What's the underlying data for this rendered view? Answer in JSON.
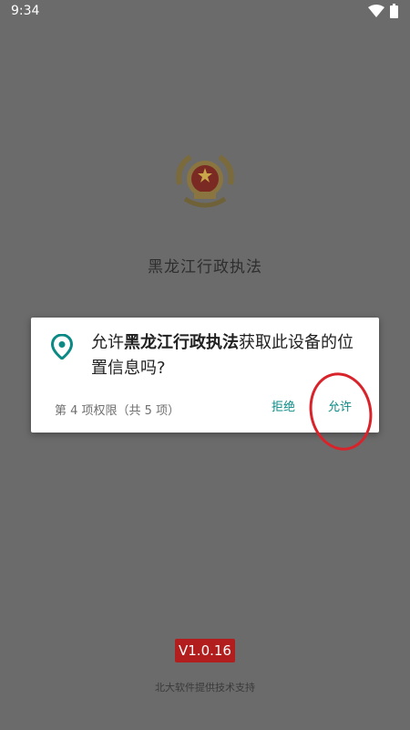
{
  "status_bar": {
    "time": "9:34",
    "icons": [
      "wifi-icon",
      "battery-icon"
    ]
  },
  "app": {
    "title": "黑龙江行政执法",
    "logo": "national-emblem"
  },
  "dialog": {
    "message_prefix": "允许",
    "message_app": "黑龙江行政执法",
    "message_suffix": "获取此设备的位置信息吗?",
    "permission_count": "第 4 项权限（共 5 项）",
    "deny_label": "拒绝",
    "allow_label": "允许",
    "icon": "location-pin-icon",
    "accent_color": "#0b8a85"
  },
  "footer": {
    "version": "V1.0.16",
    "support_text": "北大软件提供技术支持"
  },
  "colors": {
    "scrim": "#6b6b6b",
    "annotation_circle": "#d9232b",
    "version_badge": "#b21e1e"
  }
}
